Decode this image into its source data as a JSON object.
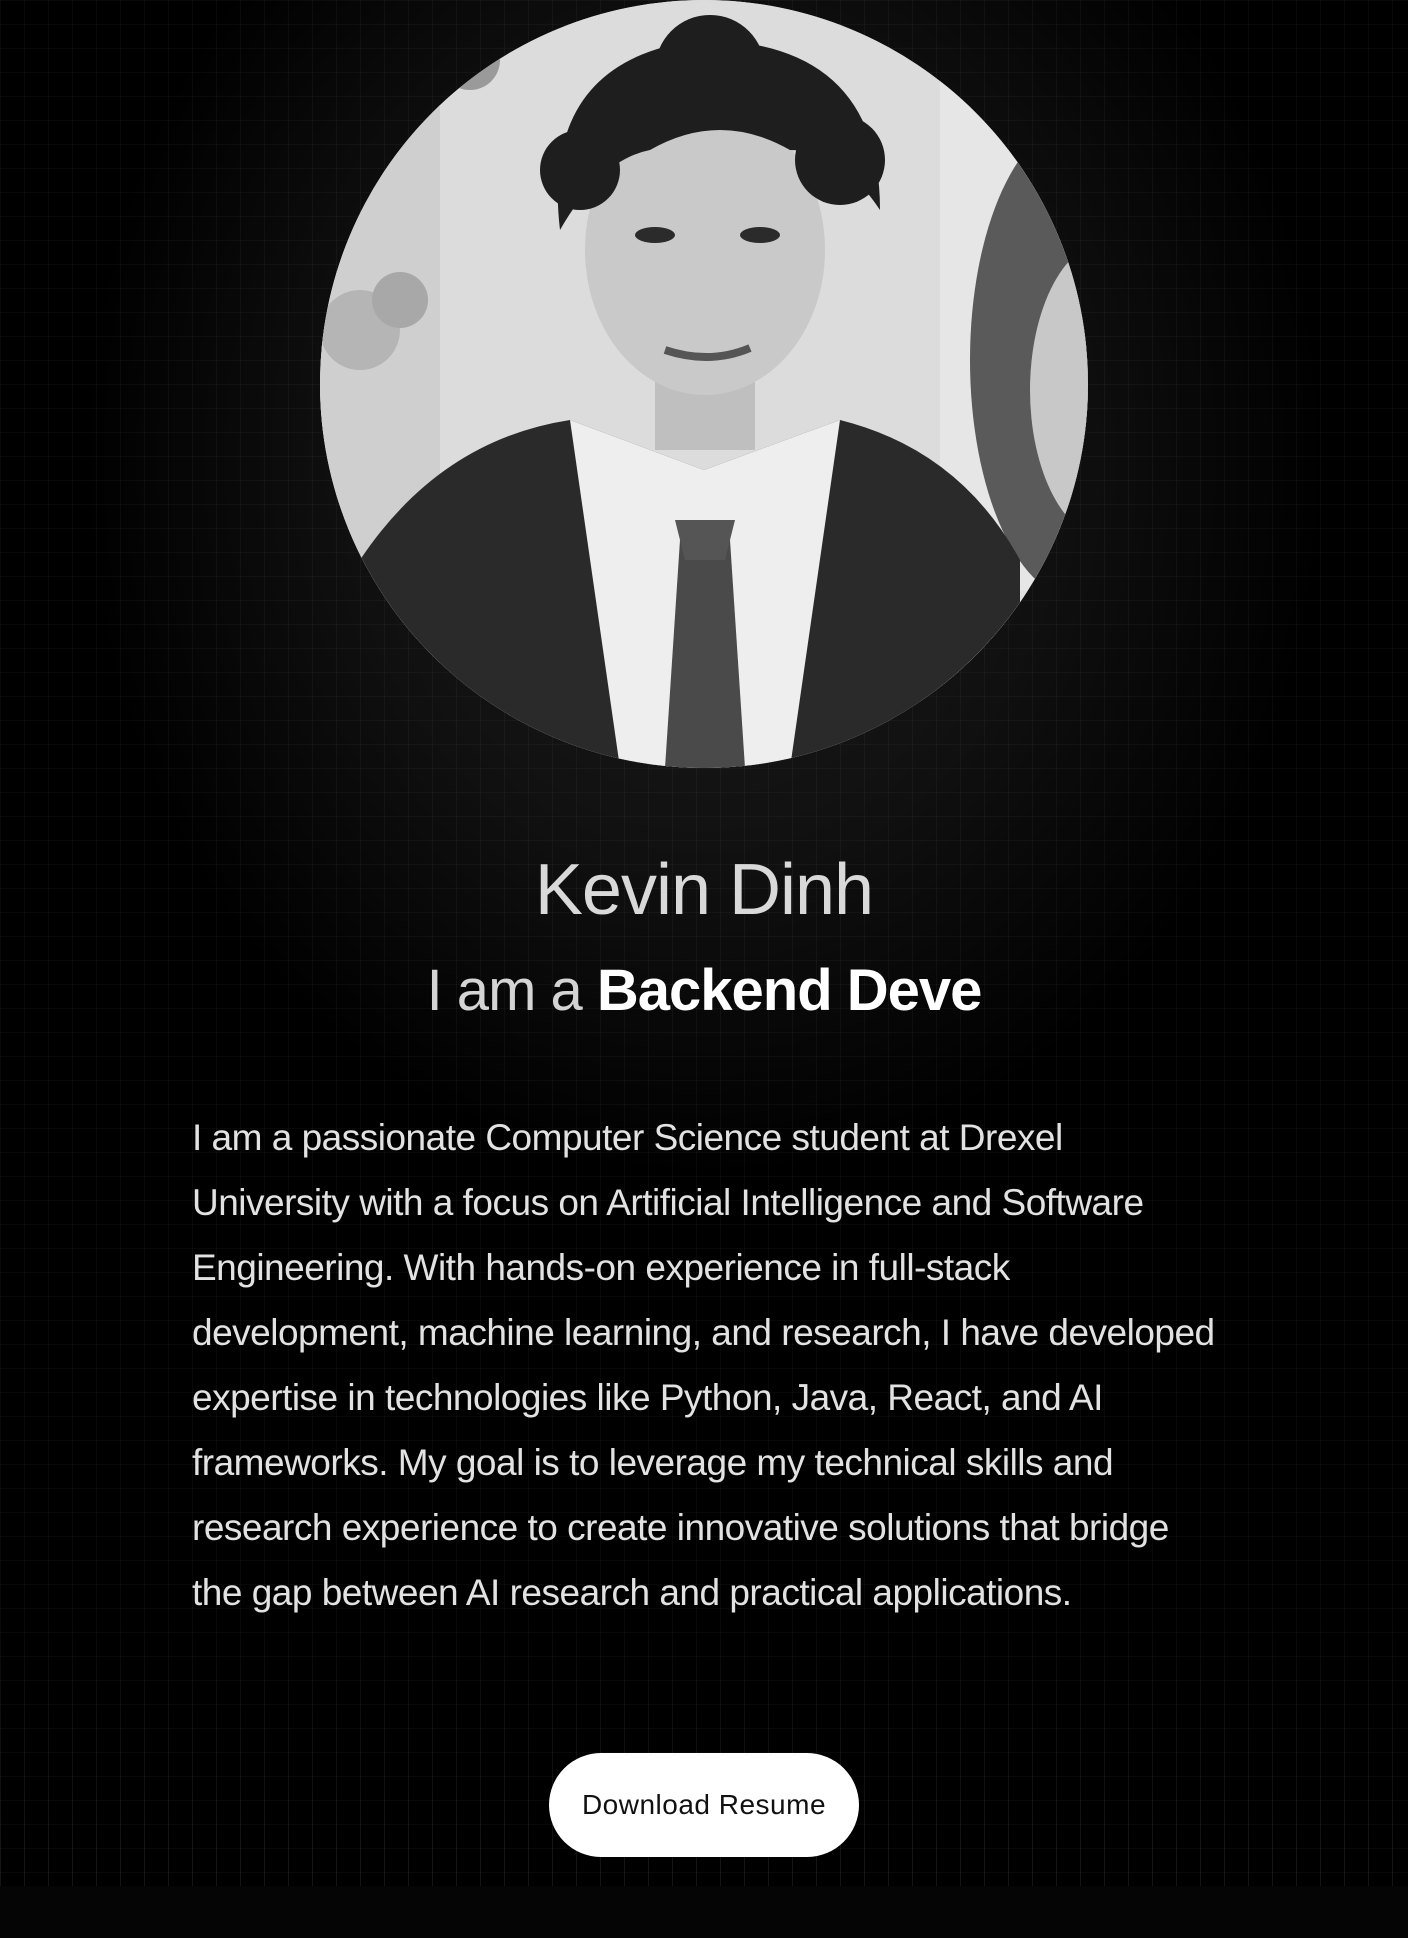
{
  "profile": {
    "photo_alt": "Kevin Dinh portrait",
    "name": "Kevin Dinh",
    "tagline_prefix": "I am a",
    "tagline_role": "Backend Deve"
  },
  "about": {
    "bio": "I am a passionate Computer Science student at Drexel University with a focus on Artificial Intelligence and Software Engineering. With hands-on experience in full-stack development, machine learning, and research, I have developed expertise in technologies like Python, Java, React, and AI frameworks. My goal is to leverage my technical skills and research experience to create innovative solutions that bridge the gap between AI research and practical applications."
  },
  "actions": {
    "download_resume_label": "Download Resume"
  },
  "theme": {
    "background": "#000000",
    "text": "#e2e2e2",
    "button_bg": "#ffffff",
    "button_text": "#111111"
  }
}
